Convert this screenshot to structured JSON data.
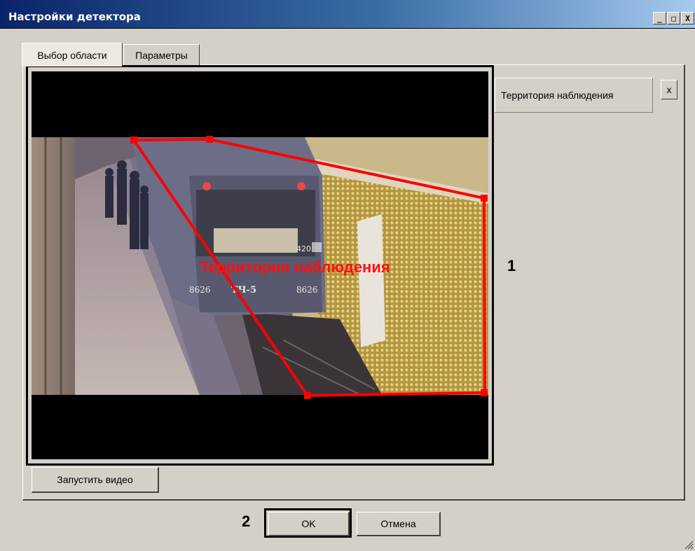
{
  "window": {
    "title": "Настройки детектора",
    "controls": {
      "minimize": "_",
      "maximize": "□",
      "close": "X"
    }
  },
  "tabs": [
    {
      "label": "Выбор области",
      "active": true
    },
    {
      "label": "Параметры",
      "active": false
    }
  ],
  "video": {
    "zone_overlay_label": "Территория наблюдения",
    "zone_color": "#ff0000",
    "train_text": {
      "left_number": "8626",
      "model": "ТЧ-5",
      "right_number": "8626",
      "route_number": "420"
    }
  },
  "zones": {
    "items": [
      {
        "label": "Территория наблюдения"
      }
    ],
    "remove_label": "x"
  },
  "buttons": {
    "start_video": "Запустить видео",
    "ok": "OK",
    "cancel": "Отмена"
  },
  "annotations": {
    "one": "1",
    "two": "2"
  }
}
